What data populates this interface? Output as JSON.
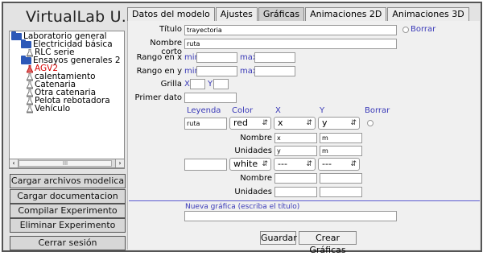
{
  "app": {
    "title": "VirtualLab U.N."
  },
  "tabs": [
    "Datos del modelo",
    "Ajustes",
    "Gráficas",
    "Animaciones 2D",
    "Animaciones 3D"
  ],
  "tree": {
    "items": [
      {
        "label": "Laboratorio general",
        "icon": "folder-icon"
      },
      {
        "label": "Electricidad básica",
        "icon": "folder-icon"
      },
      {
        "label": "RLC serie",
        "icon": "flask-icon"
      },
      {
        "label": "Ensayos generales 2",
        "icon": "folder-icon"
      },
      {
        "label": "AGV2",
        "icon": "flask-icon",
        "color": "#d60000"
      },
      {
        "label": "calentamiento",
        "icon": "flask-icon"
      },
      {
        "label": "Catenaria",
        "icon": "flask-icon"
      },
      {
        "label": "Otra catenaria",
        "icon": "flask-icon"
      },
      {
        "label": "Pelota rebotadora",
        "icon": "flask-icon"
      },
      {
        "label": "Vehículo",
        "icon": "flask-icon"
      }
    ],
    "scroll_thumb": "III"
  },
  "left_buttons": {
    "cargar_modelica": "Cargar archivos modelica",
    "cargar_doc": "Cargar documentacion",
    "compilar": "Compilar Experimento",
    "eliminar": "Eliminar Experimento",
    "cerrar": "Cerrar sesión"
  },
  "form": {
    "titulo_label": "Título",
    "titulo_value": "trayectoria",
    "borrar_label": "Borrar",
    "nombre_corto_label": "Nombre corto",
    "nombre_corto_value": "ruta",
    "rango_x_label": "Rango en x",
    "rango_y_label": "Rango en y",
    "min_label": "min",
    "max_label": "max",
    "grilla_label": "Grilla",
    "grilla_x": "X",
    "grilla_y": "Y",
    "primer_dato_label": "Primer dato"
  },
  "series": {
    "headers": {
      "leyenda": "Leyenda",
      "color": "Color",
      "x": "X",
      "y": "Y",
      "borrar": "Borrar"
    },
    "rows": [
      {
        "leyenda": "ruta",
        "color": "red",
        "x": "x",
        "y": "y",
        "nombre_x": "x",
        "nombre_y": "m",
        "unidades_x": "y",
        "unidades_y": "m"
      },
      {
        "leyenda": "",
        "color": "white",
        "x": "---",
        "y": "---",
        "nombre_x": "",
        "nombre_y": "",
        "unidades_x": "",
        "unidades_y": ""
      }
    ],
    "nombre_label": "Nombre",
    "unidades_label": "Unidades"
  },
  "nueva_grafica": {
    "label": "Nueva gráfica (escriba el título)",
    "value": ""
  },
  "actions": {
    "guardar": "Guardar",
    "crear": "Crear Gráficas"
  },
  "colors": {
    "accent_blue": "#3a3ab8",
    "folder_blue": "#2c58b8",
    "selected_red": "#d60000"
  }
}
